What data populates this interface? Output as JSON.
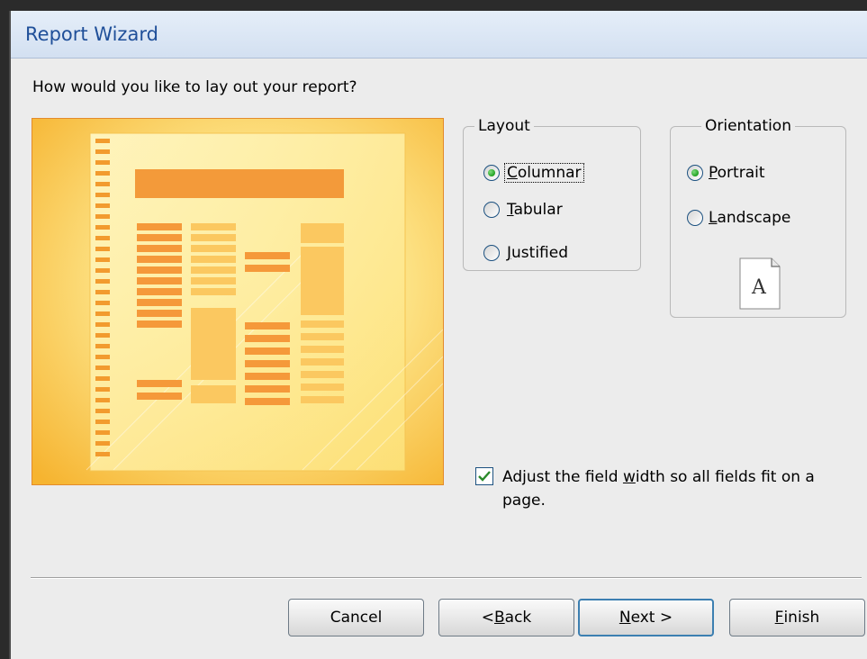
{
  "window": {
    "title": "Report Wizard"
  },
  "prompt": "How would you like to lay out your report?",
  "layout": {
    "legend": "Layout",
    "options": [
      {
        "label_pre": "",
        "label_key": "C",
        "label_post": "olumnar",
        "selected": true
      },
      {
        "label_pre": "",
        "label_key": "T",
        "label_post": "abular",
        "selected": false
      },
      {
        "label_pre": "",
        "label_key": "J",
        "label_post": "ustified",
        "selected": false
      }
    ]
  },
  "orientation": {
    "legend": "Orientation",
    "options": [
      {
        "label_pre": "",
        "label_key": "P",
        "label_post": "ortrait",
        "selected": true
      },
      {
        "label_pre": "",
        "label_key": "L",
        "label_post": "andscape",
        "selected": false
      }
    ],
    "icon_letter": "A"
  },
  "fit_option": {
    "checked": true,
    "label_pre": "Adjust the field ",
    "label_key": "w",
    "label_post": "idth so all fields fit on a page."
  },
  "buttons": {
    "cancel": "Cancel",
    "back_pre": "< ",
    "back_key": "B",
    "back_post": "ack",
    "next_key": "N",
    "next_post": "ext >",
    "finish_key": "F",
    "finish_post": "inish"
  },
  "colors": {
    "title_text": "#1f4f99",
    "preview_bg": "#f8b532",
    "preview_border": "#e38b2b",
    "radio_dot": "#21a121",
    "checkmark": "#2a8a2a"
  },
  "icons": {
    "preview": "columnar-report-preview",
    "orientation": "portrait-page-icon",
    "check": "checkmark-icon"
  }
}
